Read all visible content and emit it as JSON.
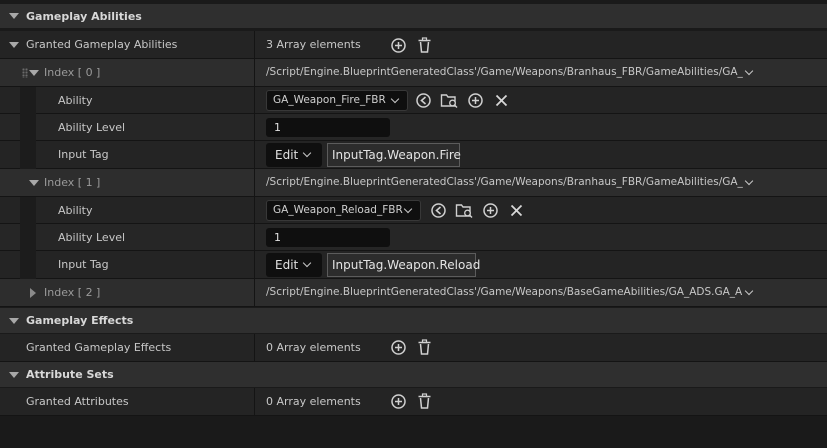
{
  "gameplay_abilities": {
    "category_title": "Gameplay Abilities",
    "granted": {
      "label": "Granted Gameplay Abilities",
      "count_text": "3 Array elements"
    },
    "items": [
      {
        "index_label": "Index [ 0 ]",
        "path": "/Script/Engine.BlueprintGeneratedClass'/Game/Weapons/Branhaus_FBR/GameAbilities/GA_",
        "ability_label": "Ability",
        "ability_value": "GA_Weapon_Fire_FBR",
        "level_label": "Ability Level",
        "level_value": "1",
        "tag_label": "Input Tag",
        "edit_label": "Edit",
        "tag_value": "InputTag.Weapon.Fire"
      },
      {
        "index_label": "Index [ 1 ]",
        "path": "/Script/Engine.BlueprintGeneratedClass'/Game/Weapons/Branhaus_FBR/GameAbilities/GA_",
        "ability_label": "Ability",
        "ability_value": "GA_Weapon_Reload_FBR",
        "level_label": "Ability Level",
        "level_value": "1",
        "tag_label": "Input Tag",
        "edit_label": "Edit",
        "tag_value": "InputTag.Weapon.Reload"
      },
      {
        "index_label": "Index [ 2 ]",
        "path": "/Script/Engine.BlueprintGeneratedClass'/Game/Weapons/BaseGameAbilities/GA_ADS.GA_A"
      }
    ]
  },
  "gameplay_effects": {
    "category_title": "Gameplay Effects",
    "granted": {
      "label": "Granted Gameplay Effects",
      "count_text": "0 Array elements"
    }
  },
  "attribute_sets": {
    "category_title": "Attribute Sets",
    "granted": {
      "label": "Granted Attributes",
      "count_text": "0 Array elements"
    }
  },
  "icons": [
    "add-element-icon",
    "delete-all-icon",
    "chevron-down-icon",
    "browse-asset-icon",
    "browse-folder-icon",
    "insert-icon",
    "clear-icon"
  ],
  "colors": {
    "background": "#1a1a1a",
    "category_bg": "#2f2f2f",
    "row_bg": "#242424",
    "index_row_bg": "#2d2d2d",
    "input_bg": "#0f0f0f",
    "tag_border": "#5c5c5c",
    "text": "#c8c8c8"
  }
}
